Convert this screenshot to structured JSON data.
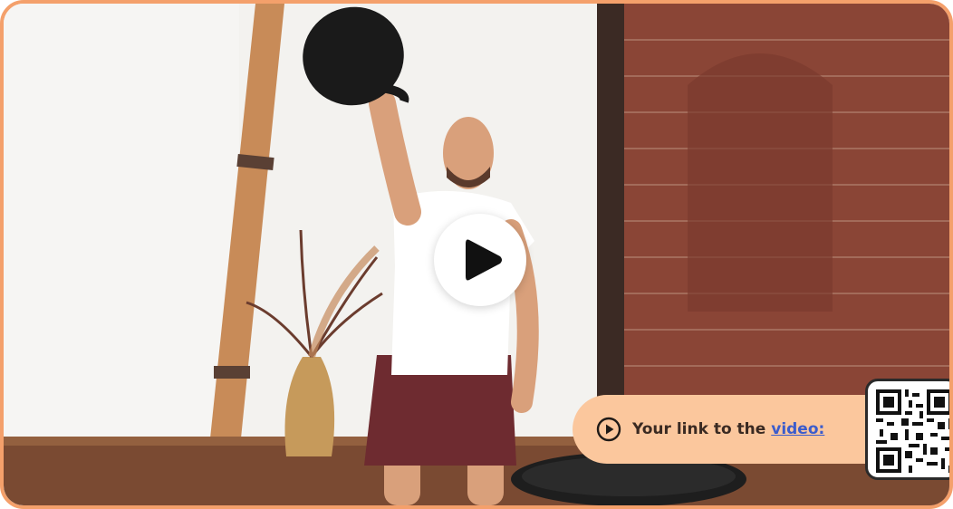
{
  "video": {
    "play_label": "Play video",
    "link_prefix": "Your link to the",
    "link_text": "video:",
    "icon": "play-circle-icon"
  },
  "colors": {
    "frame_border": "#f4a06b",
    "pill_background": "#fbc79d",
    "link": "#3b5ccc"
  },
  "qr": {
    "icon": "qr-code-icon"
  }
}
